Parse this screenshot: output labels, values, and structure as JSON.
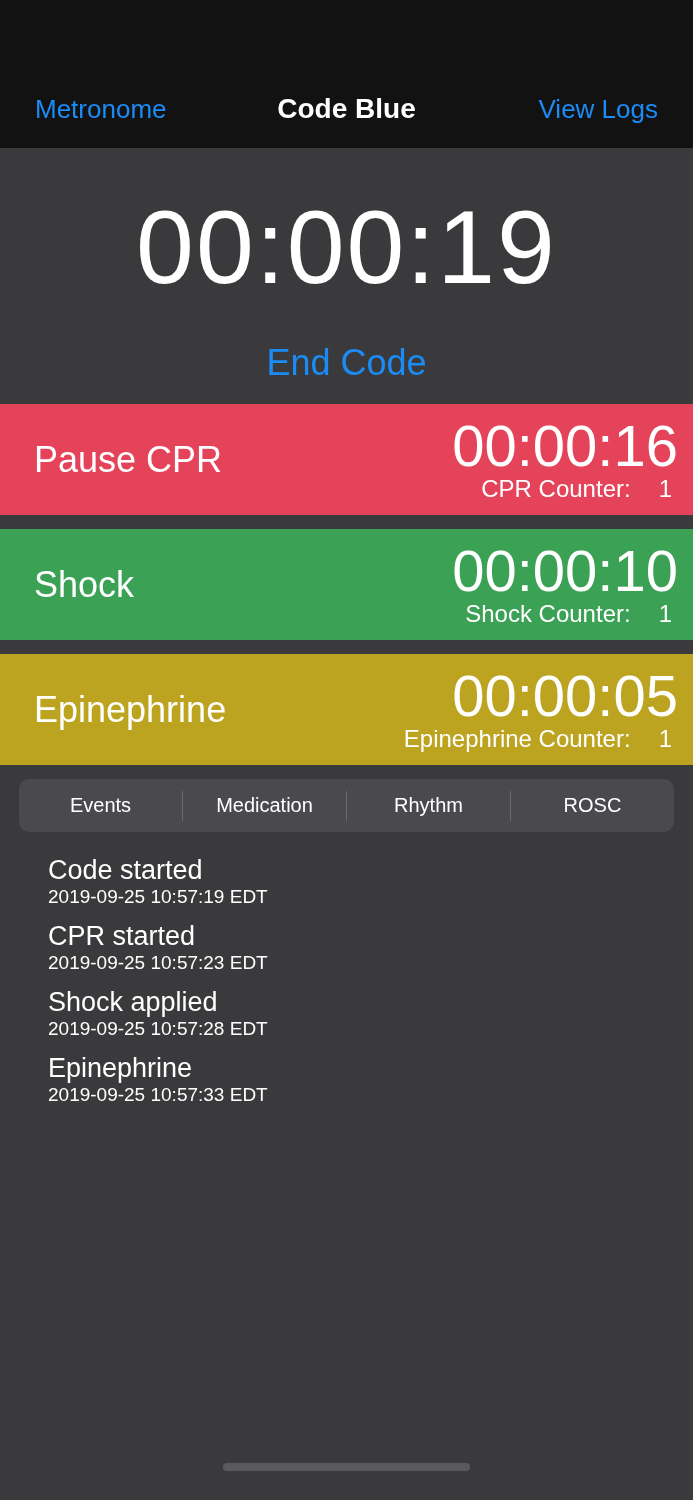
{
  "nav": {
    "left": "Metronome",
    "title": "Code Blue",
    "right": "View Logs"
  },
  "timer": "00:00:19",
  "end_button": "End Code",
  "actions": [
    {
      "label": "Pause CPR",
      "color": "#e5435a",
      "timer": "00:00:16",
      "counter_label": "CPR Counter:",
      "counter": "1"
    },
    {
      "label": "Shock",
      "color": "#3ba155",
      "timer": "00:00:10",
      "counter_label": "Shock Counter:",
      "counter": "1"
    },
    {
      "label": "Epinephrine",
      "color": "#bca421",
      "timer": "00:00:05",
      "counter_label": "Epinephrine Counter:",
      "counter": "1"
    }
  ],
  "segments": [
    {
      "label": "Events",
      "selected": false
    },
    {
      "label": "Medication",
      "selected": false
    },
    {
      "label": "Rhythm",
      "selected": false
    },
    {
      "label": "ROSC",
      "selected": false
    }
  ],
  "events": [
    {
      "title": "Code started",
      "time": "2019-09-25 10:57:19 EDT"
    },
    {
      "title": "CPR started",
      "time": "2019-09-25 10:57:23 EDT"
    },
    {
      "title": "Shock applied",
      "time": "2019-09-25 10:57:28 EDT"
    },
    {
      "title": "Epinephrine",
      "time": "2019-09-25 10:57:33 EDT"
    }
  ]
}
